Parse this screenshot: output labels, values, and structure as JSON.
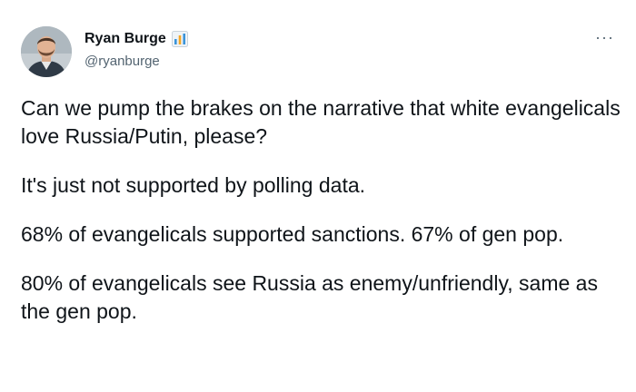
{
  "author": {
    "display_name": "Ryan Burge",
    "handle": "@ryanburge",
    "badge_icon": "bar-chart-icon",
    "badge_colors": [
      "#3b94d9",
      "#f5a623",
      "#e74c3c"
    ]
  },
  "more_menu": {
    "icon": "more-horizontal-icon",
    "glyph": "···"
  },
  "tweet": {
    "paragraphs": [
      "Can we pump the brakes on the narrative that white evangelicals love Russia/Putin, please?",
      "It's just not supported by polling data.",
      "68% of evangelicals supported sanctions. 67% of gen pop.",
      "80% of evangelicals see Russia as enemy/unfriendly, same as the gen pop."
    ]
  }
}
